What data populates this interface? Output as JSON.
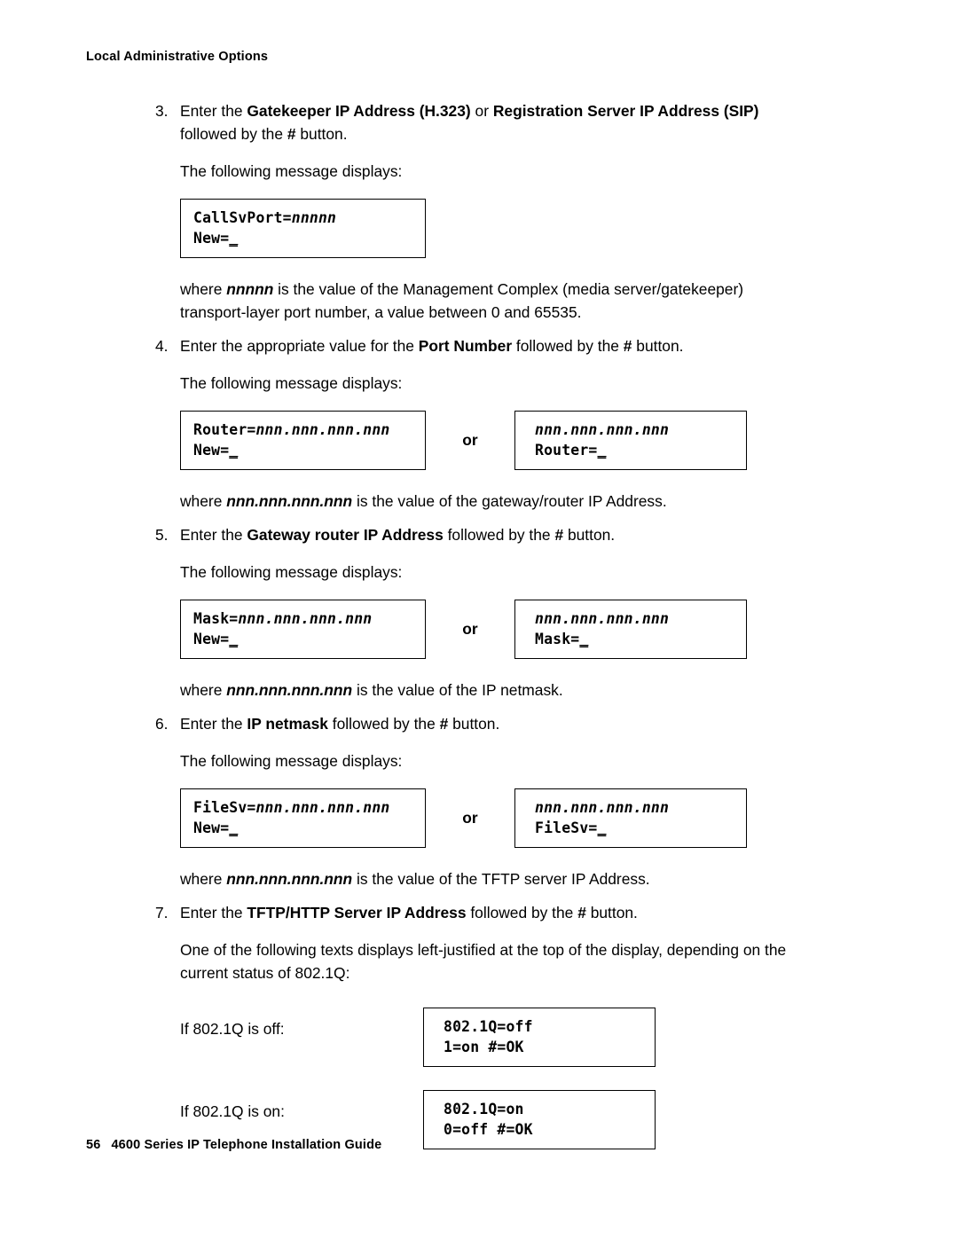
{
  "running_head": "Local Administrative Options",
  "footer": {
    "page_number": "56",
    "title": "4600 Series IP Telephone Installation Guide"
  },
  "or_label": "or",
  "steps": [
    {
      "number": "3.",
      "lead": "Enter the ",
      "bold1": "Gatekeeper IP Address (H.323)",
      "mid": " or ",
      "bold2": "Registration Server IP Address (SIP)",
      "tail_line2_pre": "followed by the ",
      "tail_bold": "#",
      "tail_post": " button.",
      "follow_text": "The following message displays:"
    },
    {
      "number": "4.",
      "lead": "Enter the appropriate value for the ",
      "bold1": "Port Number",
      "tail_pre": " followed by the ",
      "tail_bold": "#",
      "tail_post": " button.",
      "follow_text": "The following message displays:"
    },
    {
      "number": "5.",
      "lead": "Enter the ",
      "bold1": "Gateway router IP Address",
      "tail_pre": " followed by the ",
      "tail_bold": "#",
      "tail_post": " button.",
      "follow_text": "The following message displays:"
    },
    {
      "number": "6.",
      "lead": "Enter the ",
      "bold1": "IP netmask",
      "tail_pre": " followed by the ",
      "tail_bold": "#",
      "tail_post": " button.",
      "follow_text": "The following message displays:"
    },
    {
      "number": "7.",
      "lead": "Enter the ",
      "bold1": "TFTP/HTTP Server IP Address",
      "tail_pre": " followed by the ",
      "tail_bold": "#",
      "tail_post": " button.",
      "follow_line1": "One of the following texts displays left-justified at the top of the display, depending on the",
      "follow_line2": "current status of 802.1Q:"
    }
  ],
  "where_notes": {
    "callsvport_pre": "where ",
    "callsvport_var": "nnnnn",
    "callsvport_line1_post": " is the value of the Management Complex (media server/gatekeeper)",
    "callsvport_line2": "transport-layer port number, a value between 0 and 65535.",
    "router_pre": "where ",
    "router_var": "nnn.nnn.nnn.nnn",
    "router_post": " is the value of the gateway/router IP Address.",
    "mask_pre": "where ",
    "mask_var": "nnn.nnn.nnn.nnn",
    "mask_post": " is the value of the IP netmask.",
    "filesv_pre": "where ",
    "filesv_var": "nnn.nnn.nnn.nnn",
    "filesv_post": " is the value of the TFTP server IP Address."
  },
  "lcd_boxes": {
    "callsvport": {
      "line1_label": "CallSvPort=",
      "line1_var": "nnnnn",
      "line2_label": "New=",
      "line2_cursor": "_"
    },
    "router_left": {
      "line1_label": "Router=",
      "line1_var": "nnn.nnn.nnn.nnn",
      "line2_label": "New=",
      "line2_cursor": "_"
    },
    "router_right": {
      "line1_var": "nnn.nnn.nnn.nnn",
      "line2_label": "Router=",
      "line2_cursor": "_"
    },
    "mask_left": {
      "line1_label": "Mask=",
      "line1_var": "nnn.nnn.nnn.nnn",
      "line2_label": "New=",
      "line2_cursor": "_"
    },
    "mask_right": {
      "line1_var": "nnn.nnn.nnn.nnn",
      "line2_label": "Mask=",
      "line2_cursor": "_"
    },
    "filesv_left": {
      "line1_label": "FileSv=",
      "line1_var": "nnn.nnn.nnn.nnn",
      "line2_label": "New=",
      "line2_cursor": "_"
    },
    "filesv_right": {
      "line1_var": "nnn.nnn.nnn.nnn",
      "line2_label": "FileSv=",
      "line2_cursor": "_"
    },
    "q_off": {
      "line1": "802.1Q=off",
      "line2": "1=on #=OK"
    },
    "q_on": {
      "line1": "802.1Q=on",
      "line2": "0=off #=OK"
    }
  },
  "q_labels": {
    "off": "If 802.1Q is off:",
    "on": "If 802.1Q is on:"
  }
}
